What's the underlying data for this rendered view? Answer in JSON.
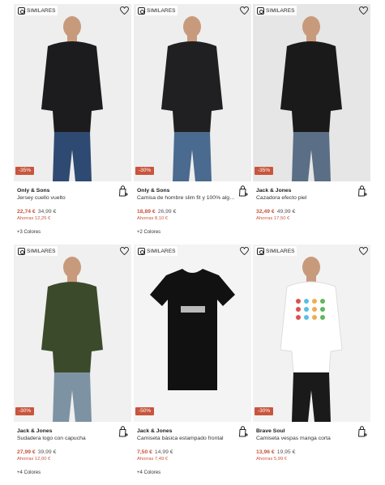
{
  "similares_label": "SIMILARES",
  "products": [
    {
      "brand": "Only & Sons",
      "name": "Jersey cuello vuelto",
      "discount": "-35%",
      "price": "22,74 €",
      "old_price": "34,99 €",
      "saving": "Ahorras 12,25 €",
      "colors": "+3 Colores",
      "top_color": "#1c1c1e",
      "bottom_color": "#2f4a72",
      "bg": "#eeeeee"
    },
    {
      "brand": "Only & Sons",
      "name": "Camisa de hombre slim fit y 100% algo...",
      "discount": "-30%",
      "price": "18,89 €",
      "old_price": "26,99 €",
      "saving": "Ahorras 8,10 €",
      "colors": "+2 Colores",
      "top_color": "#202022",
      "bottom_color": "#4a6a8f",
      "bg": "#eeeeee"
    },
    {
      "brand": "Jack & Jones",
      "name": "Cazadora efecto piel",
      "discount": "-35%",
      "price": "32,49 €",
      "old_price": "49,99 €",
      "saving": "Ahorras 17,50 €",
      "colors": "",
      "top_color": "#1a1a1a",
      "bottom_color": "#5a6e86",
      "bg": "#e6e6e6"
    },
    {
      "brand": "Jack & Jones",
      "name": "Sudadera logo con capucha",
      "discount": "-30%",
      "price": "27,99 €",
      "old_price": "39,99 €",
      "saving": "Ahorras 12,00 €",
      "colors": "+4 Colores",
      "top_color": "#3b4a2a",
      "bottom_color": "#7d93a3",
      "bg": "#f0f0f0"
    },
    {
      "brand": "Jack & Jones",
      "name": "Camiseta básica estampado frontal",
      "discount": "-50%",
      "price": "7,50 €",
      "old_price": "14,99 €",
      "saving": "Ahorras 7,49 €",
      "colors": "+4 Colores",
      "top_color": "#111111",
      "bottom_color": "",
      "bg": "#f4f4f4"
    },
    {
      "brand": "Brave Soul",
      "name": "Camiseta vespas manga corta",
      "discount": "-30%",
      "price": "13,96 €",
      "old_price": "19,95 €",
      "saving": "Ahorras 5,99 €",
      "colors": "",
      "top_color": "#ffffff",
      "bottom_color": "#1a1a1a",
      "bg": "#f2f2f2"
    }
  ]
}
